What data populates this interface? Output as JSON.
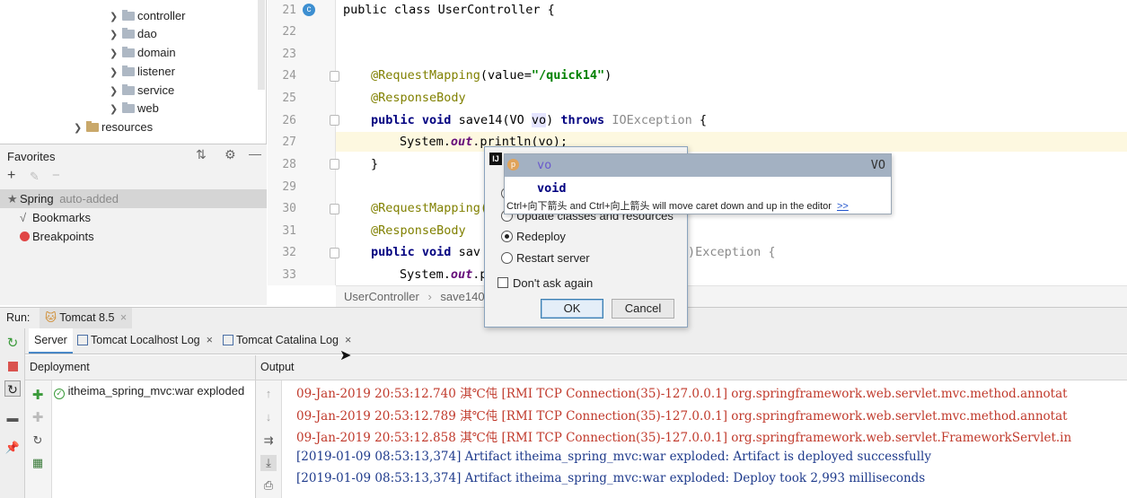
{
  "project_tree": {
    "items": [
      {
        "label": "controller",
        "expanded": false
      },
      {
        "label": "dao",
        "expanded": false
      },
      {
        "label": "domain",
        "expanded": false
      },
      {
        "label": "listener",
        "expanded": false
      },
      {
        "label": "service",
        "expanded": false
      },
      {
        "label": "web",
        "expanded": false
      }
    ],
    "resources_label": "resources"
  },
  "favorites": {
    "title": "Favorites",
    "items": [
      {
        "label": "Spring",
        "suffix": "auto-added"
      },
      {
        "label": "Bookmarks",
        "suffix": ""
      },
      {
        "label": "Breakpoints",
        "suffix": ""
      }
    ]
  },
  "editor": {
    "line_numbers": [
      "21",
      "22",
      "23",
      "24",
      "25",
      "26",
      "27",
      "28",
      "29",
      "30",
      "31",
      "32",
      "33"
    ],
    "line21": "public class UserController {",
    "anno_mapping": "@RequestMapping",
    "mapping_args_open": "(value=",
    "mapping_path": "\"/quick14\"",
    "mapping_args_close": ")",
    "anno_body": "@ResponseBody",
    "sig_public": "public",
    "sig_void": "void",
    "sig_name": "save14(VO ",
    "sig_param": "vo",
    "sig_close": ")",
    "sig_throws": "throws",
    "sig_exc": "IOException",
    "sig_brace": "{",
    "print_system": "System.",
    "print_out": "out",
    "print_rest": ".println(vo);",
    "close_brace": "}",
    "mapping_partial": "@RequestMapping(",
    "body_partial": "@ResponseBody",
    "save_partial": "sav",
    "exc_partial": ")Exception {",
    "system_partial": "System.",
    "out_partial": "out",
    "p_partial": ".p"
  },
  "breadcrumb": {
    "class": "UserController",
    "separator": "›",
    "method": "save140"
  },
  "run": {
    "label": "Run:",
    "config": "Tomcat 8.5",
    "tabs": [
      {
        "label": "Server",
        "active": true,
        "closable": false
      },
      {
        "label": "Tomcat Localhost Log",
        "active": false,
        "closable": true
      },
      {
        "label": "Tomcat Catalina Log",
        "active": false,
        "closable": true
      }
    ],
    "deployment_header": "Deployment",
    "output_header": "Output",
    "artifact": "itheima_spring_mvc:war exploded",
    "output_lines": [
      {
        "text": "09-Jan-2019 20:53:12.740 淇℃伅 [RMI TCP Connection(35)-127.0.0.1] org.springframework.web.servlet.mvc.method.annotat",
        "color": "#c0392b"
      },
      {
        "text": "09-Jan-2019 20:53:12.789 淇℃伅 [RMI TCP Connection(35)-127.0.0.1] org.springframework.web.servlet.mvc.method.annotat",
        "color": "#c0392b"
      },
      {
        "text": "09-Jan-2019 20:53:12.858 淇℃伅 [RMI TCP Connection(35)-127.0.0.1] org.springframework.web.servlet.FrameworkServlet.in",
        "color": "#c0392b"
      },
      {
        "text": "[2019-01-09 08:53:13,374] Artifact itheima_spring_mvc:war exploded: Artifact is deployed successfully",
        "color": "#1f3b8c"
      },
      {
        "text": "[2019-01-09 08:53:13,374] Artifact itheima_spring_mvc:war exploded: Deploy took 2,993 milliseconds",
        "color": "#1f3b8c"
      }
    ]
  },
  "dialog": {
    "option_update": "Update classes and resources",
    "option_redeploy": "Redeploy",
    "option_restart": "Restart server",
    "selected": "Redeploy",
    "dont_ask": "Don't ask again",
    "ok": "OK",
    "cancel": "Cancel"
  },
  "completion": {
    "items": [
      {
        "badge": "p",
        "name": "vo",
        "type": "VO"
      },
      {
        "badge": "",
        "name": "void",
        "type": ""
      }
    ],
    "hint": "Ctrl+向下箭头 and Ctrl+向上箭头 will move caret down and up in the editor",
    "hint_link": ">>"
  },
  "colors": {
    "accent": "#4a88c7",
    "selection": "#a3b1c2",
    "error_log": "#c0392b",
    "info_log": "#1f3b8c"
  }
}
